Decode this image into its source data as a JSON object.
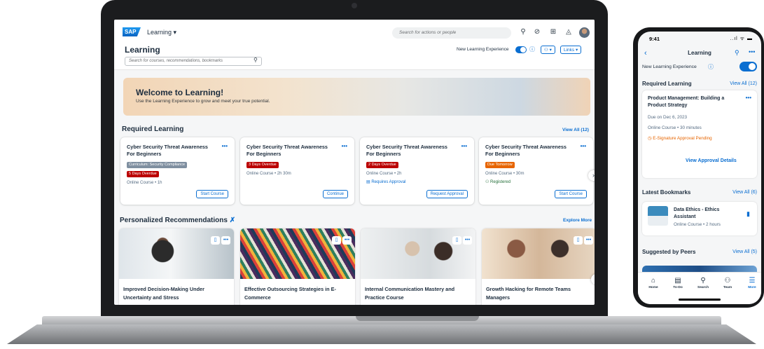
{
  "laptop": {
    "brand": "SAP",
    "app_title": "Learning ▾",
    "shell_search_placeholder": "Search for actions or people",
    "shell_icons": [
      "search-icon",
      "target-icon",
      "notes-icon",
      "bell-icon"
    ],
    "page_title": "Learning",
    "page_search_placeholder": "Search for courses, recommendations, bookmarks",
    "new_experience_label": "New Learning Experience",
    "people_button": "⚇ ▾",
    "links_button": "Links ▾",
    "hero": {
      "title": "Welcome to Learning!",
      "subtitle": "Use the Learning Experience to grow and meet your true potential."
    },
    "required": {
      "title": "Required Learning",
      "view_all": "View All (12)",
      "cards": [
        {
          "title": "Cyber Security Threat Awareness For Beginners",
          "tags": [
            {
              "text": "Curriculum: Security Compliance",
              "type": "grey"
            },
            {
              "text": "5 Days Overdue",
              "type": "red"
            }
          ],
          "meta": [
            {
              "text": "Online Course • 1h",
              "type": "plain"
            }
          ],
          "button": "Start Course"
        },
        {
          "title": "Cyber Security Threat Awareness For Beginners",
          "tags": [
            {
              "text": "3 Days Overdue",
              "type": "red"
            }
          ],
          "meta": [
            {
              "text": "Online Course • 2h 30m",
              "type": "plain"
            }
          ],
          "button": "Continue"
        },
        {
          "title": "Cyber Security Threat Awareness For Beginners",
          "tags": [
            {
              "text": "2 Days Overdue",
              "type": "red"
            }
          ],
          "meta": [
            {
              "text": "Online Course • 2h",
              "type": "plain"
            },
            {
              "text": "▤ Requires Approval",
              "type": "approval"
            }
          ],
          "button": "Request Approval"
        },
        {
          "title": "Cyber Security Threat Awareness For Beginners",
          "tags": [
            {
              "text": "Due Tomorrow",
              "type": "orange"
            }
          ],
          "meta": [
            {
              "text": "Online Course • 30m",
              "type": "plain"
            },
            {
              "text": "⚇ Registered",
              "type": "registered"
            }
          ],
          "button": "Start Course"
        }
      ]
    },
    "recommendations": {
      "title": "Personalized Recommendations",
      "explore": "Explore More",
      "cards": [
        {
          "title": "Improved Decision-Making Under Uncertainty and Stress"
        },
        {
          "title": "Effective Outsourcing Strategies in E-Commerce"
        },
        {
          "title": "Internal Communication Mastery and Practice Course"
        },
        {
          "title": "Growth Hacking for Remote Teams Managers"
        }
      ]
    }
  },
  "phone": {
    "time": "9:41",
    "status_right": "..ıl ᯤ ▬",
    "title": "Learning",
    "new_experience_label": "New Learning Experience",
    "required": {
      "title": "Required Learning",
      "view_all": "View All (12)",
      "card_title": "Product Management: Building a Product Strategy",
      "due": "Due on Dec 6, 2023",
      "meta": "Online Course • 30 minutes",
      "pending": "◷ E-Signature Approval Pending",
      "button": "View Approval Details"
    },
    "bookmarks": {
      "title": "Latest Bookmarks",
      "view_all": "View All (6)",
      "item_title": "Data Ethics - Ethics Assistant",
      "item_meta": "Online Course • 2 hours"
    },
    "peers": {
      "title": "Suggested by Peers",
      "view_all": "View All (5)"
    },
    "tabs": [
      {
        "label": "Home",
        "icon": "home-icon",
        "glyph": "⌂"
      },
      {
        "label": "To-Do",
        "icon": "clipboard-icon",
        "glyph": "▤"
      },
      {
        "label": "Search",
        "icon": "search-icon",
        "glyph": "⚲"
      },
      {
        "label": "Team",
        "icon": "team-icon",
        "glyph": "⚇"
      },
      {
        "label": "More",
        "icon": "list-icon",
        "glyph": "☰"
      }
    ]
  },
  "colors": {
    "accent": "#0a6ed1",
    "overdue": "#bb0000",
    "due_soon": "#e76500",
    "title": "#1d2d3e"
  }
}
